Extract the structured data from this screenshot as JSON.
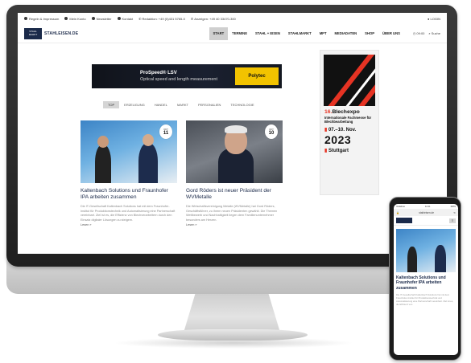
{
  "colors": {
    "brand_navy": "#1b2a4a",
    "accent_red": "#e63323",
    "polytec_yellow": "#f2c300",
    "nav_active_bg": "#cfcfcf"
  },
  "infobar": {
    "items": [
      {
        "icon": "circle-icon",
        "label": "Regeln & Impressum"
      },
      {
        "icon": "circle-icon",
        "label": "Mein Konto"
      },
      {
        "icon": "circle-icon",
        "label": "Newsletter"
      },
      {
        "icon": "mail-icon",
        "label": "Kontakt"
      },
      {
        "icon": "phone-icon",
        "label": "Redaktion: +49 (0)431 5765-0"
      },
      {
        "icon": "phone-icon",
        "label": "Anzeigen: +49 40 33470-300"
      }
    ],
    "login_label": "LOGIN"
  },
  "header": {
    "logo_line1": "STAHL",
    "logo_line2": "MARKT",
    "logo_text": "STAHLEISEN.DE",
    "nav": [
      "START",
      "TERMINE",
      "STAHL + EISEN",
      "STAHLMARKT",
      "MPT",
      "MEDIADATEN",
      "SHOP",
      "ÜBER UNS"
    ],
    "active_nav": "START",
    "time": "09:00",
    "search_label": "Suche"
  },
  "banner": {
    "title": "ProSpeed® LSV",
    "subtitle": "Optical speed and length measurement",
    "brand": "Polytec"
  },
  "filters": [
    "TOP",
    "ERZEUGUNG",
    "HANDEL",
    "MARKT",
    "PERSONALIEN",
    "TECHNOLOGIE"
  ],
  "cards": [
    {
      "month": "OKT",
      "day": "11",
      "title": "Kaltenbach Solutions und Fraunhofer IPA arbeiten zusammen",
      "excerpt": "Die IT-Gesellschaft Kaltenbach Solutions hat mit dem Fraunhofer-Institut für Produktionstechnik und Automatisierung eine Partnerschaft vereinbart. Ziel ist es, die Effizienz von Blechverarbeitern durch den Einsatz digitaler Lösungen zu steigern.",
      "more": "Lesen »"
    },
    {
      "month": "OKT",
      "day": "10",
      "title": "Gord Röders ist neuer Präsident der WVMetalle",
      "excerpt": "Die Wirtschaftsvereinigung Metalle (WVMetalle) hat Gord Röders, Geschäftsführer, zu ihrem neuen Präsidenten gewählt. Die Themen Wettbewerb und Nachhaltigkeit liegen dem Familienunternehmer besonders am Herzen.",
      "more": "Lesen »"
    }
  ],
  "ad": {
    "edition_number": "16.",
    "edition_name": "Blechexpo",
    "description": "Internationale Fachmesse für Blechbearbeitung",
    "dates": "07.–10. Nov.",
    "year": "2023",
    "city": "Stuttgart"
  },
  "phone": {
    "time": "12:41",
    "carrier": "Vodafone",
    "battery": "100%",
    "url": "stahleisen.de",
    "menu_icon": "≡",
    "article_title": "Kaltenbach Solutions und Fraunhofer IPA arbeiten zusammen",
    "article_excerpt": "Die IT-Gesellschaft Kaltenbach Solutions hat mit dem Fraunhofer-Institut für Produktionstechnik und Automatisierung eine Partnerschaft vereinbart. Ziel ist es, die Effizienz von"
  }
}
